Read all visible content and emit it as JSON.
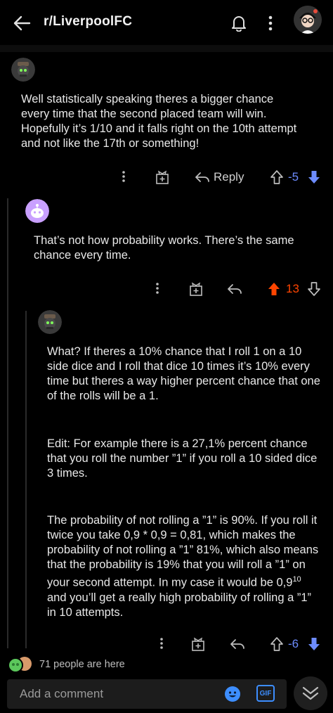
{
  "header": {
    "title": "r/LiverpoolFC",
    "back_icon": "arrow-left-icon",
    "bell_icon": "bell-icon",
    "more_icon": "more-vertical-icon"
  },
  "comments": [
    {
      "text": "Well statistically speaking theres a bigger chance every time that the second placed team will win. Hopefully it’s 1/10 and it falls right on the 10th attempt and not like the 17th or something!",
      "reply_label": "Reply",
      "score": "-5",
      "vote_state": "downvoted"
    },
    {
      "text": "That’s not how probability works.  There’s the same chance every time.",
      "score": "13",
      "vote_state": "upvoted"
    },
    {
      "paragraphs": [
        "What? If theres a 10% chance that I roll 1 on a 10 side dice and I roll that dice 10 times it’s 10% every time but theres a way higher  percent chance that one of the rolls will be a 1.",
        "Edit: For example there is a 27,1% percent chance that you roll the number ”1” if you roll a 10 sided dice 3 times.",
        "The probability of not rolling a ”1” is 90%. If you roll it twice you take 0,9 * 0,9 = 0,81, which makes the probability of not rolling a ”1” 81%, which also means that the probability is 19% that you will roll a ”1” on your second attempt. In my case it would be 0,9",
        "10",
        " and you’ll get a really high probability of rolling a ”1” in 10 attempts."
      ],
      "score": "-6",
      "vote_state": "downvoted"
    }
  ],
  "footer": {
    "presence_text": "71 people are here",
    "composer_placeholder": "Add a comment",
    "emoji_icon": "emoji-icon",
    "gif_label": "GIF",
    "scroll_down_icon": "chevron-double-down-icon"
  },
  "colors": {
    "upvote": "#ff4500",
    "downvote": "#6d8cff",
    "background": "#000000"
  }
}
